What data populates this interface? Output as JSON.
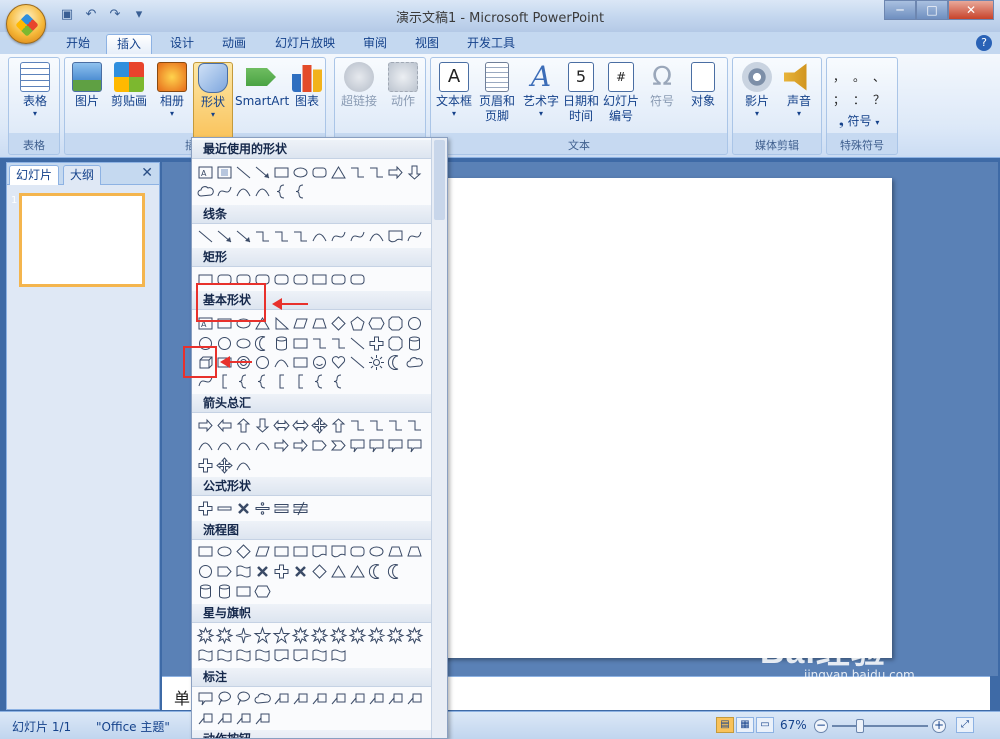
{
  "window": {
    "title": "演示文稿1 - Microsoft PowerPoint",
    "controls": [
      "minimize",
      "maximize",
      "close"
    ]
  },
  "tabs": [
    "开始",
    "插入",
    "设计",
    "动画",
    "幻灯片放映",
    "审阅",
    "视图",
    "开发工具"
  ],
  "active_tab": "插入",
  "ribbon": {
    "groups": [
      {
        "label": "表格",
        "buttons": [
          {
            "label": "表格",
            "dropdown": true
          }
        ]
      },
      {
        "label": "插",
        "buttons": [
          {
            "label": "图片"
          },
          {
            "label": "剪贴画"
          },
          {
            "label": "相册",
            "dropdown": true
          },
          {
            "label": "形状",
            "dropdown": true,
            "pressed": true
          },
          {
            "label": "SmartArt"
          },
          {
            "label": "图表"
          }
        ]
      },
      {
        "label": "",
        "buttons": [
          {
            "label": "超链接",
            "disabled": true
          },
          {
            "label": "动作",
            "disabled": true
          }
        ]
      },
      {
        "label": "文本",
        "buttons": [
          {
            "label": "文本框",
            "dropdown": true
          },
          {
            "label": "页眉和",
            "label2": "页脚"
          },
          {
            "label": "艺术字",
            "dropdown": true
          },
          {
            "label": "日期和",
            "label2": "时间"
          },
          {
            "label": "幻灯片",
            "label2": "编号"
          },
          {
            "label": "符号",
            "disabled": true
          },
          {
            "label": "对象"
          }
        ]
      },
      {
        "label": "媒体剪辑",
        "buttons": [
          {
            "label": "影片",
            "dropdown": true
          },
          {
            "label": "声音",
            "dropdown": true
          }
        ]
      },
      {
        "label": "特殊符号",
        "buttons": [
          {
            "label": "符号",
            "dropdown": true
          }
        ],
        "symbols": [
          "，",
          "。",
          "、",
          "；",
          "：",
          "？"
        ]
      }
    ]
  },
  "left_pane": {
    "tabs": [
      "幻灯片",
      "大纲"
    ],
    "close": "✕",
    "slide_number": "1"
  },
  "shapes_menu": {
    "sections": [
      {
        "title": "最近使用的形状"
      },
      {
        "title": "线条"
      },
      {
        "title": "矩形"
      },
      {
        "title": "基本形状"
      },
      {
        "title": "箭头总汇"
      },
      {
        "title": "公式形状"
      },
      {
        "title": "流程图"
      },
      {
        "title": "星与旗帜"
      },
      {
        "title": "标注"
      },
      {
        "title": "动作按钮"
      }
    ]
  },
  "notes_text": "单",
  "status": {
    "slide": "幻灯片 1/1",
    "theme": "\"Office 主题\"",
    "zoom": "67%",
    "zoom_level_percent": 67
  },
  "watermark": {
    "text": "Bai经验",
    "url": "jingyan.baidu.com"
  },
  "colors": {
    "accent": "#e8312c",
    "ribbon": "#dde9f8",
    "workspace": "#5a81b6"
  }
}
